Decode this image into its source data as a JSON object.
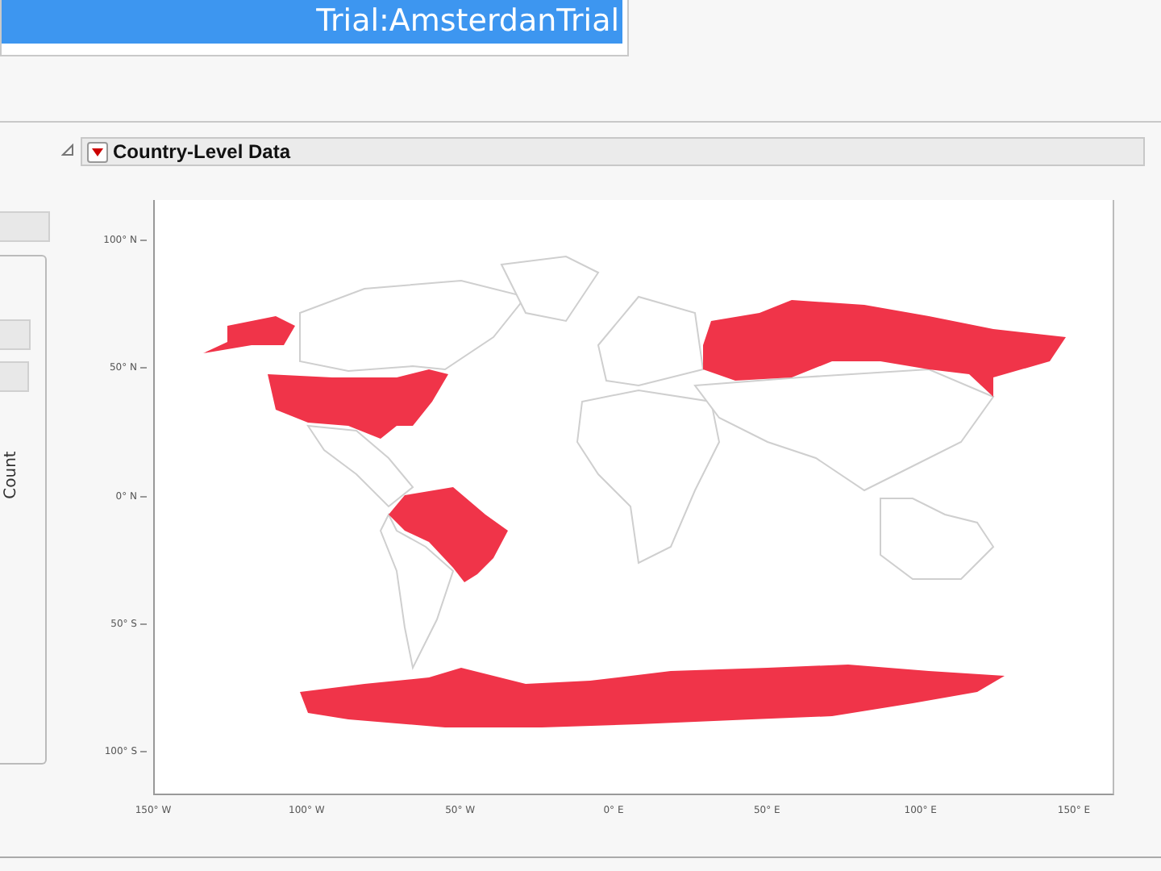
{
  "window": {
    "title": "Trial:AmsterdanTrial"
  },
  "panel": {
    "title": "Country-Level Data",
    "expanded": true
  },
  "side_panel": {
    "axis_label": "Count"
  },
  "map": {
    "y_ticks": [
      "100° N",
      "50° N",
      "0° N",
      "50° S",
      "100° S"
    ],
    "x_ticks": [
      "150° W",
      "100° W",
      "50° W",
      "0° E",
      "50° E",
      "100° E",
      "150° E"
    ]
  }
}
